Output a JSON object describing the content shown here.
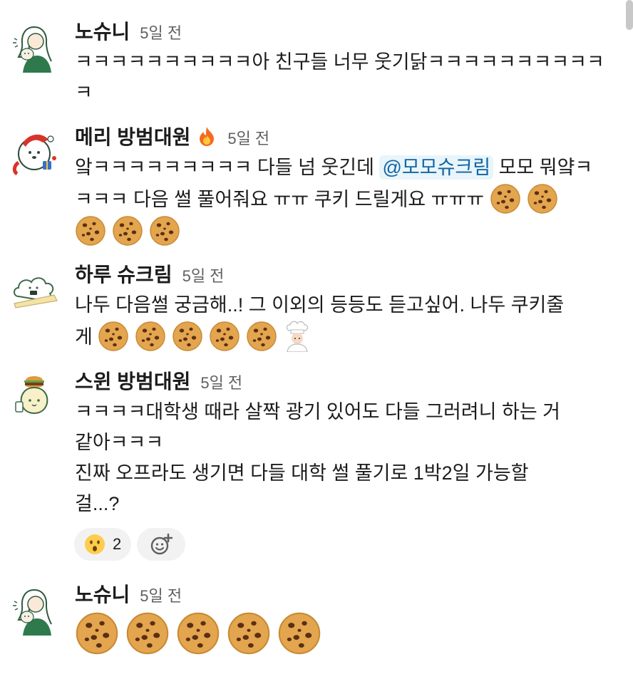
{
  "messages": [
    {
      "author": "노슈니",
      "time": "5일 전",
      "avatar_icon": "girl-with-pet-avatar-icon",
      "lines": [
        "ㅋㅋㅋㅋㅋㅋㅋㅋㅋㅋ아 친구들 너무 웃기닭ㅋㅋㅋㅋㅋㅋㅋㅋㅋㅋ",
        "ㅋ"
      ]
    },
    {
      "author": "메리 방범대원",
      "time": "5일 전",
      "author_emoji": "fire-icon",
      "avatar_icon": "santa-dog-avatar-icon",
      "text_before_mention": "앜ㅋㅋㅋㅋㅋㅋㅋㅋㅋ 다들 넘 웃긴데 ",
      "mention": "@모모슈크림",
      "line1_after_mention": " 모모 뭐얔ㅋ",
      "line2": "ㅋㅋㅋ 다음 썰 풀어줘요 ㅠㅠ 쿠키 드릴게요 ㅠㅠㅠ",
      "cookie_count": 5
    },
    {
      "author": "하루 슈크림",
      "time": "5일 전",
      "avatar_icon": "cloud-creature-avatar-icon",
      "line1": "나두 다음썰 궁금해..! 그 이외의 등등도 듣고싶어. 나두 쿠키줄",
      "line2": "게",
      "cookie_count": 5,
      "trailing_emoji": "chef-icon"
    },
    {
      "author": "스윈 방범대원",
      "time": "5일 전",
      "avatar_icon": "burger-lightbulb-avatar-icon",
      "lines": [
        "ㅋㅋㅋㅋ대학생 때라 살짝 광기 있어도 다들 그러려니 하는 거",
        "같아ㅋㅋㅋ",
        "진짜 오프라도 생기면 다들 대학 썰 풀기로 1박2일 가능할",
        "걸...?"
      ],
      "reactions": [
        {
          "emoji": "hushed-face-icon",
          "count": "2"
        }
      ],
      "add_reaction_icon": "add-reaction-icon"
    },
    {
      "author": "노슈니",
      "time": "5일 전",
      "avatar_icon": "girl-with-pet-avatar-icon",
      "cookie_count": 5
    }
  ],
  "colors": {
    "mention_bg": "#e8f5fa",
    "mention_text": "#1264a3",
    "timestamp": "#616061",
    "reaction_bg": "#f2f2f2"
  }
}
